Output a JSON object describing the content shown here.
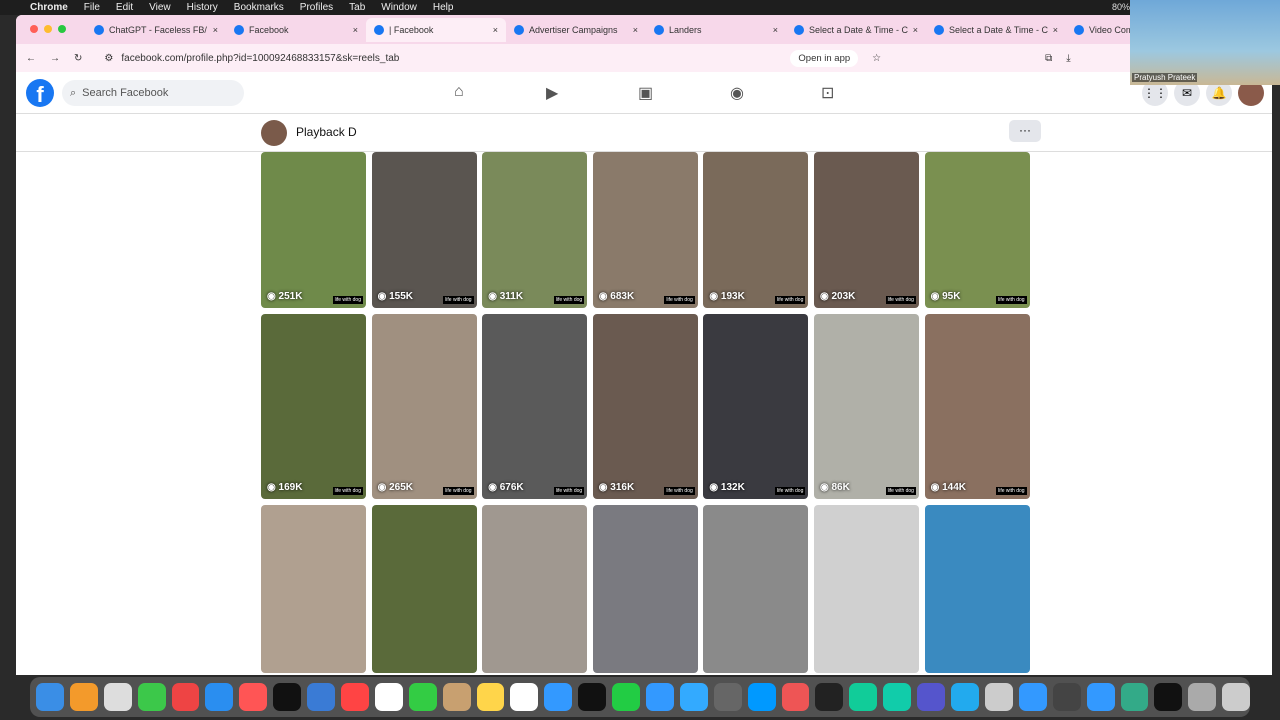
{
  "menubar": {
    "app": "Chrome",
    "items": [
      "File",
      "Edit",
      "View",
      "History",
      "Bookmarks",
      "Profiles",
      "Tab",
      "Window",
      "Help"
    ],
    "battery": "80%"
  },
  "tabs": [
    {
      "title": "ChatGPT - Faceless FB/",
      "active": false
    },
    {
      "title": "Facebook",
      "active": false
    },
    {
      "title": "| Facebook",
      "active": true
    },
    {
      "title": "Advertiser Campaigns",
      "active": false
    },
    {
      "title": "Landers",
      "active": false
    },
    {
      "title": "Select a Date & Time - C",
      "active": false
    },
    {
      "title": "Select a Date & Time - C",
      "active": false
    },
    {
      "title": "Video Compre",
      "active": false
    }
  ],
  "toolbar": {
    "url": "facebook.com/profile.php?id=100092468833157&sk=reels_tab",
    "open_in_app": "Open in app"
  },
  "fb": {
    "search_placeholder": "Search Facebook",
    "brand_color": "#1877f2"
  },
  "profile": {
    "name": "Playback D",
    "more": "···"
  },
  "reels": {
    "tag": "life with dog",
    "items": [
      {
        "views": "251K",
        "color": "#6f8a4a"
      },
      {
        "views": "155K",
        "color": "#5a5550"
      },
      {
        "views": "311K",
        "color": "#7a8a5a"
      },
      {
        "views": "683K",
        "color": "#8a7a6a"
      },
      {
        "views": "193K",
        "color": "#7a6a5a"
      },
      {
        "views": "203K",
        "color": "#6a5a50"
      },
      {
        "views": "95K",
        "color": "#7a9050"
      },
      {
        "views": "169K",
        "color": "#5a6a3a"
      },
      {
        "views": "265K",
        "color": "#a09080"
      },
      {
        "views": "676K",
        "color": "#5a5a5a"
      },
      {
        "views": "316K",
        "color": "#6a5a50"
      },
      {
        "views": "132K",
        "color": "#3a3a40"
      },
      {
        "views": "86K",
        "color": "#b0b0a8"
      },
      {
        "views": "144K",
        "color": "#8a7060"
      },
      {
        "views": "",
        "color": "#b0a090"
      },
      {
        "views": "",
        "color": "#5a6a3a"
      },
      {
        "views": "",
        "color": "#a09890"
      },
      {
        "views": "",
        "color": "#7a7a80"
      },
      {
        "views": "",
        "color": "#8a8a8a"
      },
      {
        "views": "",
        "color": "#d0d0d0"
      },
      {
        "views": "",
        "color": "#3a8ac0"
      }
    ]
  },
  "webcam": {
    "name": "Pratyush Prateek"
  }
}
